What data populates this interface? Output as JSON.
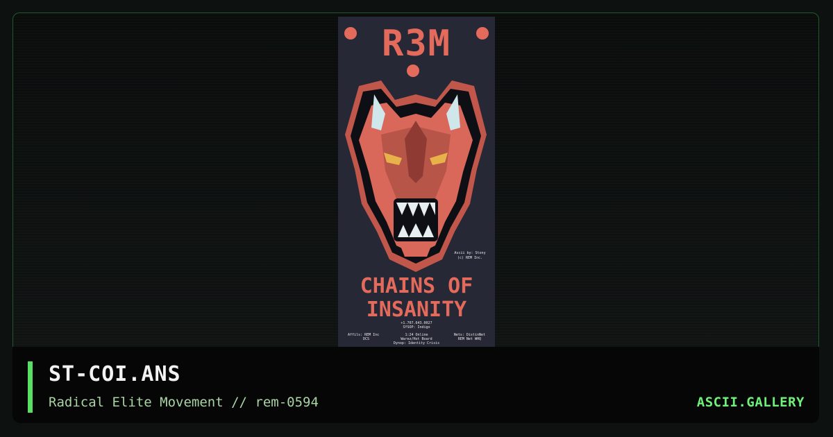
{
  "artwork": {
    "logo": "R3M",
    "headline_line1": "CHAINS OF",
    "headline_line2": "INSANITY",
    "credit_line1": "Ascii by: Stony",
    "credit_line2": "(c) REM Inc.",
    "phone": "+1.707.643.0027",
    "sysop": "SYSOP: Indigo",
    "affils": "Affils: REM Inc",
    "affils2": "DCS",
    "nodes": "1:24 Online",
    "warez": "Warez/Hot Board",
    "dynop": "Dynop: Identity Crisis",
    "nets": "Nets: DistinNet",
    "nets2": "REM Net WHQ",
    "colors": {
      "bg": "#262836",
      "red": "#e46a5c",
      "dark_red": "#8f3b34",
      "horn": "#cfe6ea",
      "eye": "#e8b14a",
      "outline": "#0e0f14"
    }
  },
  "footer": {
    "title": "ST-COI.ANS",
    "subtitle": "Radical Elite Movement // rem-0594",
    "brand": "ASCII.GALLERY"
  },
  "theme": {
    "accent": "#57e064",
    "brand_color": "#6ef07a",
    "border": "#1f5a2b"
  }
}
